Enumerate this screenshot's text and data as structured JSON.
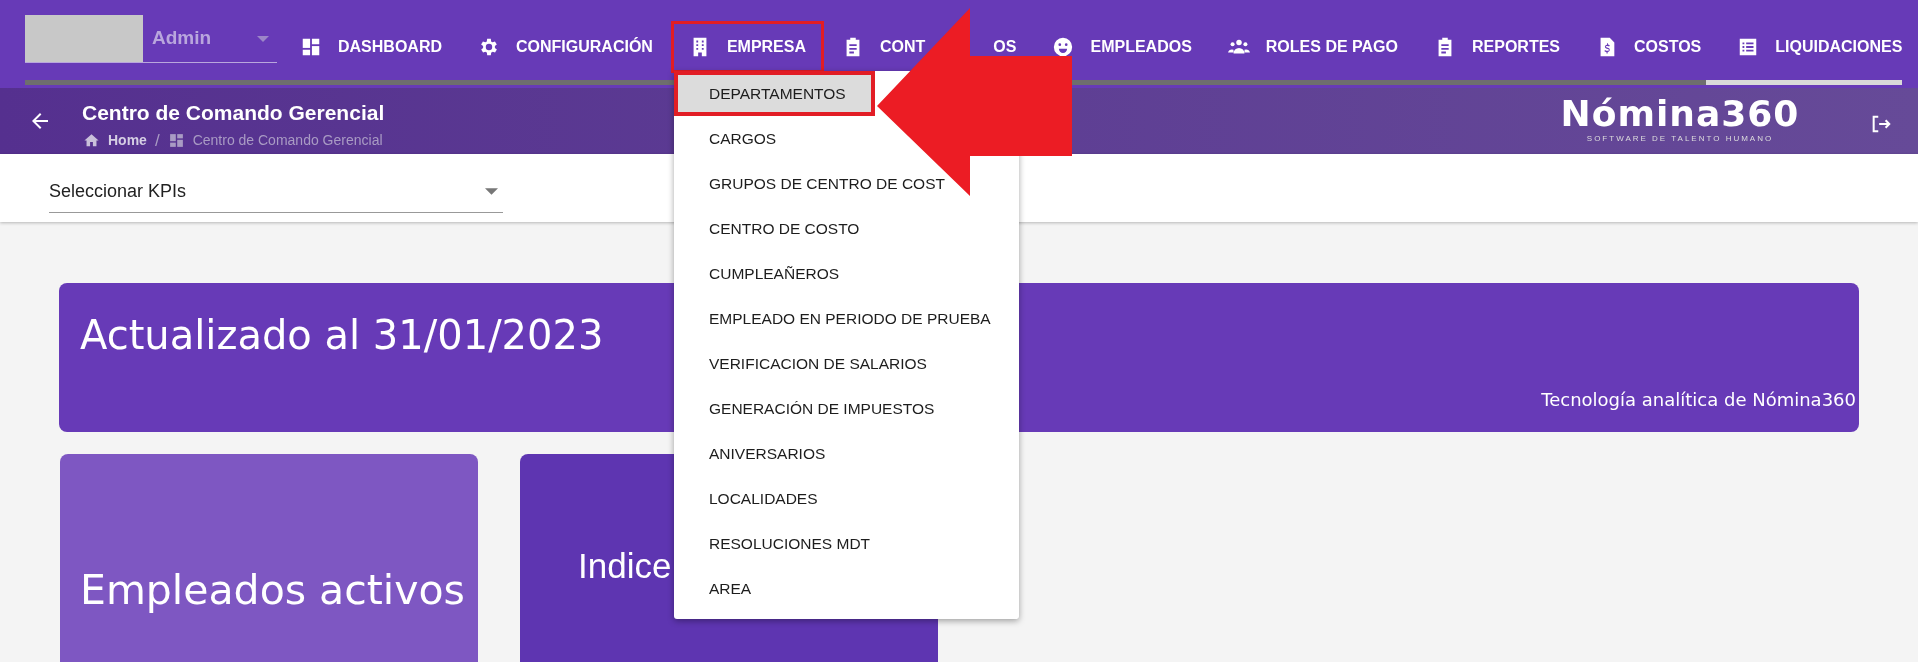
{
  "user": {
    "name": "Admin"
  },
  "nav": [
    {
      "label": "DASHBOARD",
      "annotated": false
    },
    {
      "label": "CONFIGURACIÓN",
      "annotated": false
    },
    {
      "label": "EMPRESA",
      "annotated": true
    },
    {
      "label": "CONT",
      "label_tail": "OS",
      "annotated": false
    },
    {
      "label": "EMPLEADOS",
      "annotated": false
    },
    {
      "label": "ROLES DE PAGO",
      "annotated": false
    },
    {
      "label": "REPORTES",
      "annotated": false
    },
    {
      "label": "COSTOS",
      "annotated": false
    },
    {
      "label": "LIQUIDACIONES",
      "annotated": false
    }
  ],
  "header": {
    "title": "Centro de Comando Gerencial",
    "breadcrumb": [
      "Home",
      "/",
      "Centro de Comando Gerencial"
    ],
    "logo": "Nómina360",
    "logo_tagline": "SOFTWARE DE TALENTO HUMANO"
  },
  "kpi_select": {
    "placeholder": "Seleccionar KPIs"
  },
  "banner": {
    "title": "Actualizado al 31/01/2023",
    "subtitle": "Tecnología analítica de Nómina360"
  },
  "cards": [
    {
      "title": "Empleados activos",
      "color": "#7e57c2"
    },
    {
      "title": "Indice",
      "color": "#5e35b1"
    }
  ],
  "menu": [
    {
      "label": "DEPARTAMENTOS",
      "selected": true,
      "annotated": true
    },
    {
      "label": "CARGOS",
      "selected": false,
      "annotated": false
    },
    {
      "label": "GRUPOS DE CENTRO DE COST",
      "selected": false,
      "annotated": false
    },
    {
      "label": "CENTRO DE COSTO",
      "selected": false,
      "annotated": false
    },
    {
      "label": "CUMPLEAÑEROS",
      "selected": false,
      "annotated": false
    },
    {
      "label": "EMPLEADO EN PERIODO DE PRUEBA",
      "selected": false,
      "annotated": false
    },
    {
      "label": "VERIFICACION DE SALARIOS",
      "selected": false,
      "annotated": false
    },
    {
      "label": "GENERACIÓN DE IMPUESTOS",
      "selected": false,
      "annotated": false
    },
    {
      "label": "ANIVERSARIOS",
      "selected": false,
      "annotated": false
    },
    {
      "label": "LOCALIDADES",
      "selected": false,
      "annotated": false
    },
    {
      "label": "RESOLUCIONES MDT",
      "selected": false,
      "annotated": false
    },
    {
      "label": "AREA",
      "selected": false,
      "annotated": false
    }
  ]
}
